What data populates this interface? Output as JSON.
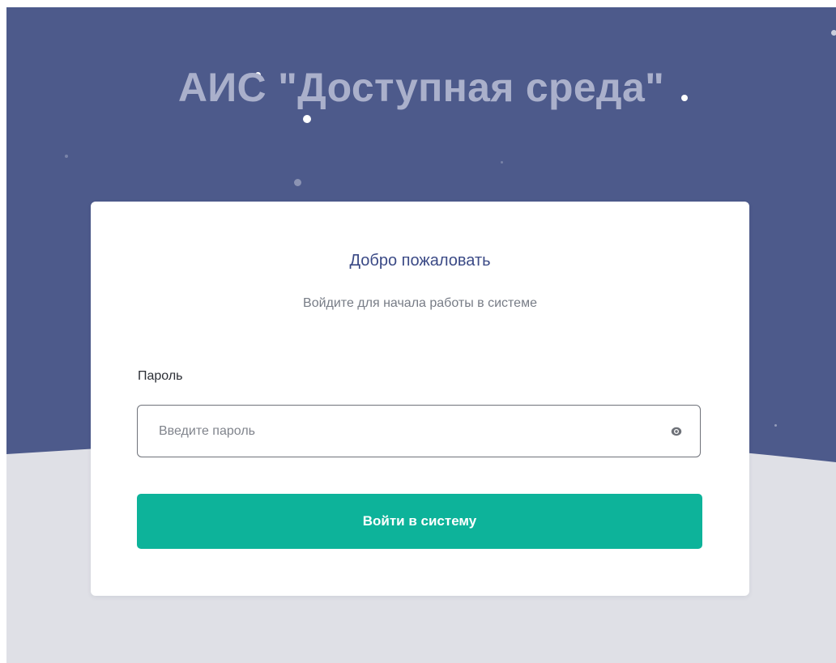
{
  "header": {
    "title": "АИС \"Доступная среда\""
  },
  "login_card": {
    "welcome": "Добро пожаловать",
    "subtitle": "Войдите для начала работы в системе",
    "password_label": "Пароль",
    "password_placeholder": "Введите пароль",
    "password_value": "",
    "toggle_icon": "eye-icon",
    "submit_label": "Войти в систему"
  },
  "colors": {
    "hero_background": "#4d5a8b",
    "page_background": "#dfe0e6",
    "title_text": "#aab0cb",
    "welcome_text": "#3b4a86",
    "accent_button": "#0db39a"
  }
}
